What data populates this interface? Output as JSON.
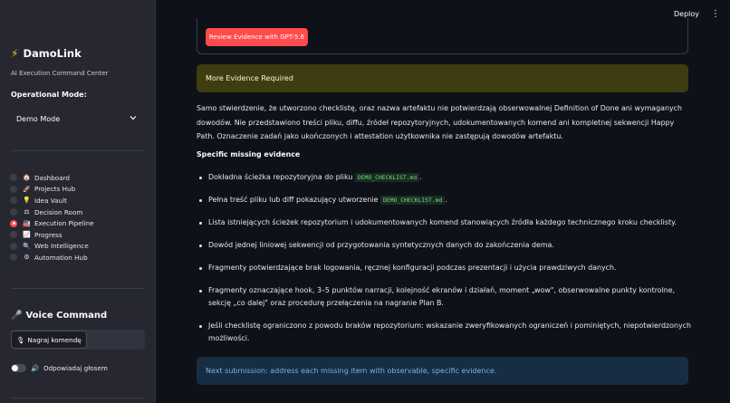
{
  "topbar": {
    "deploy": "Deploy",
    "menu": "⋮"
  },
  "sidebar": {
    "brand_icon": "⚡",
    "brand": "DamoLink",
    "subtitle": "AI Execution Command Center",
    "mode_label": "Operational Mode:",
    "mode_value": "Demo Mode",
    "nav": [
      {
        "emoji": "🏠",
        "label": "Dashboard",
        "selected": false
      },
      {
        "emoji": "🚀",
        "label": "Projects Hub",
        "selected": false
      },
      {
        "emoji": "💡",
        "label": "Idea Vault",
        "selected": false
      },
      {
        "emoji": "⚖",
        "label": "Decision Room",
        "selected": false
      },
      {
        "emoji": "🏭",
        "label": "Execution Pipeline",
        "selected": true
      },
      {
        "emoji": "📈",
        "label": "Progress",
        "selected": false
      },
      {
        "emoji": "🔍",
        "label": "Web Intelligence",
        "selected": false
      },
      {
        "emoji": "⚙",
        "label": "Automation Hub",
        "selected": false
      }
    ],
    "voice_icon": "🎤",
    "voice_title": "Voice Command",
    "voice_btn_icon": "🎙",
    "voice_btn": "Nagraj komendę",
    "toggle_icon": "🔊",
    "toggle_label": "Odpowiadaj głosem"
  },
  "main": {
    "review_button": "Review Evidence with GPT-5.6",
    "warning": "More Evidence Required",
    "paragraph": "Samo stwierdzenie, że utworzono checklistę, oraz nazwa artefaktu nie potwierdzają obserwowalnej Definition of Done ani wymaganych dowodów. Nie przedstawiono treści pliku, diffu, źródeł repozytoryjnych, udokumentowanych komend ani kompletnej sekwencji Happy Path. Oznaczenie zadań jako ukończonych i attestation użytkownika nie zastępują dowodów artefaktu.",
    "missing_heading": "Specific missing evidence",
    "items": [
      {
        "text": "Dokładna ścieżka repozytoryjna do pliku ",
        "code": "DEMO_CHECKLIST.md",
        "after": "."
      },
      {
        "text": "Pełna treść pliku lub diff pokazujący utworzenie ",
        "code": "DEMO_CHECKLIST.md",
        "after": "."
      },
      {
        "text": "Lista istniejących ścieżek repozytorium i udokumentowanych komend stanowiących źródła każdego technicznego kroku checklisty.",
        "code": "",
        "after": ""
      },
      {
        "text": "Dowód jednej liniowej sekwencji od przygotowania syntetycznych danych do zakończenia dema.",
        "code": "",
        "after": ""
      },
      {
        "text": "Fragmenty potwierdzające brak logowania, ręcznej konfiguracji podczas prezentacji i użycia prawdziwych danych.",
        "code": "",
        "after": ""
      },
      {
        "text": "Fragmenty oznaczające hook, 3–5 punktów narracji, kolejność ekranów i działań, moment „wow\", obserwowalne punkty kontrolne, sekcję „co dalej\" oraz procedurę przełączenia na nagranie Plan B.",
        "code": "",
        "after": ""
      },
      {
        "text": "Jeśli checklistę ograniczono z powodu braków repozytorium: wskazanie zweryfikowanych ograniczeń i pominiętych, niepotwierdzonych możliwości.",
        "code": "",
        "after": ""
      }
    ],
    "info": "Next submission: address each missing item with observable, specific evidence."
  }
}
